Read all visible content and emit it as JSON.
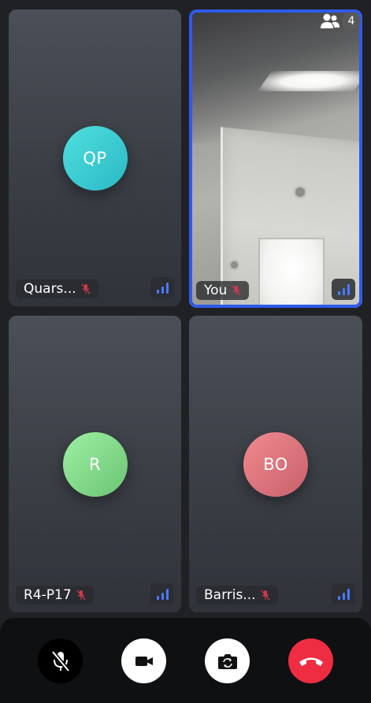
{
  "participants_badge": {
    "icon": "people-icon",
    "count": "4"
  },
  "tiles": [
    {
      "initials": "QP",
      "name": "Quars...",
      "avatar_color": "#36c6cf",
      "muted": true,
      "signal": "strong"
    },
    {
      "name": "You",
      "is_self": true,
      "muted": true,
      "signal": "strong",
      "highlight_color": "#2f5bea"
    },
    {
      "initials": "R",
      "name": "R4-P17",
      "avatar_color": "#7fd886",
      "muted": true,
      "signal": "strong"
    },
    {
      "initials": "BO",
      "name": "Barris...",
      "avatar_color": "#de737b",
      "muted": true,
      "signal": "strong"
    }
  ],
  "controls": {
    "mic": {
      "icon": "mic-off-icon",
      "state": "muted"
    },
    "video": {
      "icon": "video-camera-icon"
    },
    "flip": {
      "icon": "switch-camera-icon"
    },
    "hangup": {
      "icon": "hang-up-icon",
      "color": "#ee2d43"
    }
  }
}
